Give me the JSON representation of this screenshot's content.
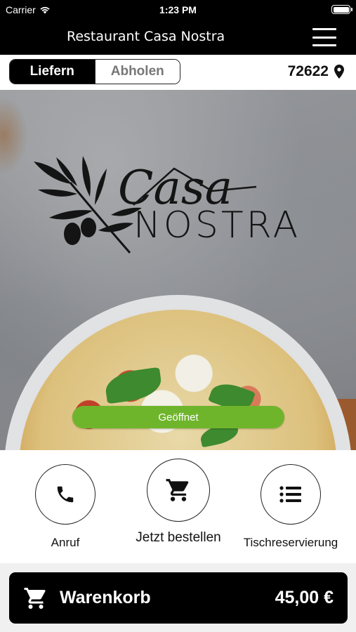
{
  "status_bar": {
    "carrier": "Carrier",
    "time": "1:23 PM"
  },
  "header": {
    "title": "Restaurant Casa Nostra",
    "menu_icon": "hamburger-menu-icon"
  },
  "mode_toggle": {
    "deliver": "Liefern",
    "pickup": "Abholen",
    "selected": "Liefern"
  },
  "location": {
    "zip": "72622",
    "icon": "location-pin-icon"
  },
  "logo": {
    "line1": "Casa",
    "line2": "NOSTRA"
  },
  "status_badge": {
    "label": "Geöffnet",
    "color": "#6fb52c"
  },
  "actions": [
    {
      "label": "Anruf",
      "icon": "phone-icon"
    },
    {
      "label": "Jetzt bestellen",
      "icon": "cart-icon"
    },
    {
      "label": "Tischreservierung",
      "icon": "list-icon"
    }
  ],
  "cart": {
    "label": "Warenkorb",
    "total": "45,00 €",
    "icon": "cart-icon"
  }
}
